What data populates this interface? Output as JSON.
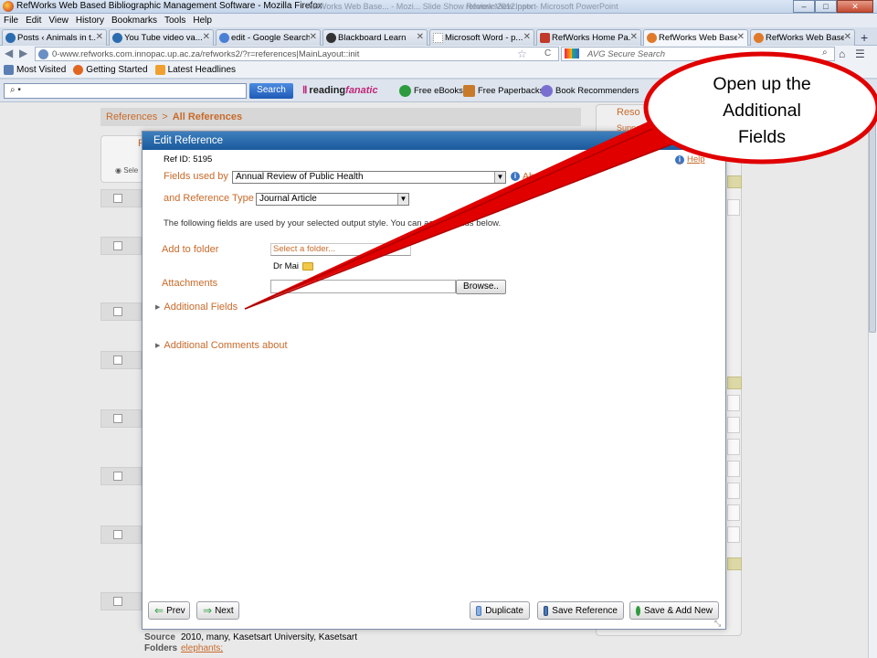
{
  "window": {
    "title": "RefWorks Web Based Bibliographic Management Software - Mozilla Firefox",
    "ghost_left": "RefWorks Web Base... - Mozi...   Slide Show   Review   View   Insert",
    "ghost_right": "refworks2012.pptx - Microsoft PowerPoint",
    "minimize": "–",
    "maximize": "□",
    "close": "✕"
  },
  "menu": [
    "File",
    "Edit",
    "View",
    "History",
    "Bookmarks",
    "Tools",
    "Help"
  ],
  "tabs": [
    {
      "label": "Posts ‹ Animals in t...",
      "icon_color": "#2b6cb0"
    },
    {
      "label": "You Tube video va...",
      "icon_color": "#2b6cb0"
    },
    {
      "label": "edit - Google Search",
      "icon_color": "#4a7fd6"
    },
    {
      "label": "Blackboard Learn",
      "icon_color": "#333333"
    },
    {
      "label": "Microsoft Word - p...",
      "icon_color": "#ffffff"
    },
    {
      "label": "RefWorks Home Pa...",
      "icon_color": "#c0392b"
    },
    {
      "label": "RefWorks Web Base...",
      "icon_color": "#e07a2a"
    },
    {
      "label": "RefWorks Web Base...",
      "icon_color": "#e07a2a"
    }
  ],
  "tab_close": "✕",
  "new_tab": "+",
  "nav": {
    "url": "0-www.refworks.com.innopac.up.ac.za/refworks2/?r=references|MainLayout::init",
    "search_placeholder": "AVG Secure Search",
    "back": "◀",
    "forward": "▶",
    "star": "☆",
    "reload": "C",
    "home": "⌂",
    "addon": "☰"
  },
  "bookmarks": [
    {
      "label": "Most Visited",
      "icon_color": "#5b7fb5"
    },
    {
      "label": "Getting Started",
      "icon_color": "#e2661f"
    },
    {
      "label": "Latest Headlines",
      "icon_color": "#f0a030"
    }
  ],
  "toolbar": {
    "search_value": "⌕ •",
    "search_button": "Search",
    "reading_a": "reading",
    "reading_b": "fanatic",
    "items": [
      {
        "label": "Free eBooks",
        "icon_color": "#2e9b3e"
      },
      {
        "label": "Free Paperbacks",
        "icon_color": "#c87a2a"
      },
      {
        "label": "Book Recommenders",
        "icon_color": "#7a6fd0"
      }
    ]
  },
  "page": {
    "breadcrumb_1": "References",
    "breadcrumb_sep": ">",
    "breadcrumb_2": "All References",
    "bg_panel_label": "R",
    "bg_radio": "◉ Sele",
    "right_panel_head": "Reso",
    "right_panel_sub": "Suppo",
    "footer_source_key": "Source",
    "footer_source_val": "2010, many, Kasetsart University, Kasetsart",
    "footer_folders_key": "Folders",
    "footer_folders_val": "elephants;"
  },
  "dialog": {
    "title": "Edit Reference",
    "ref_id": "Ref ID: 5195",
    "help": "Help",
    "fields_used_by_label": "Fields used by",
    "fields_used_by_value": "Annual Review of Public Health",
    "about_label": "About the",
    "ref_type_label": "and Reference Type",
    "ref_type_value": "Journal Article",
    "note": "The following fields are used by your selected output style. You can access              fields below.",
    "add_to_folder_label": "Add to folder",
    "folder_placeholder": "Select a folder...",
    "folder_owner": "Dr Mai",
    "attachments_label": "Attachments",
    "browse": "Browse..",
    "additional_fields": "Additional Fields",
    "additional_comments": "Additional Comments about",
    "expand_glyph": "▶",
    "prev": "Prev",
    "next": "Next",
    "duplicate": "Duplicate",
    "save_reference": "Save Reference",
    "save_add_new": "Save & Add New",
    "arrow_left": "⇐",
    "arrow_right": "⇒"
  },
  "callout": {
    "line1": "Open up the",
    "line2": "Additional",
    "line3": "Fields",
    "color": "#e00000"
  }
}
